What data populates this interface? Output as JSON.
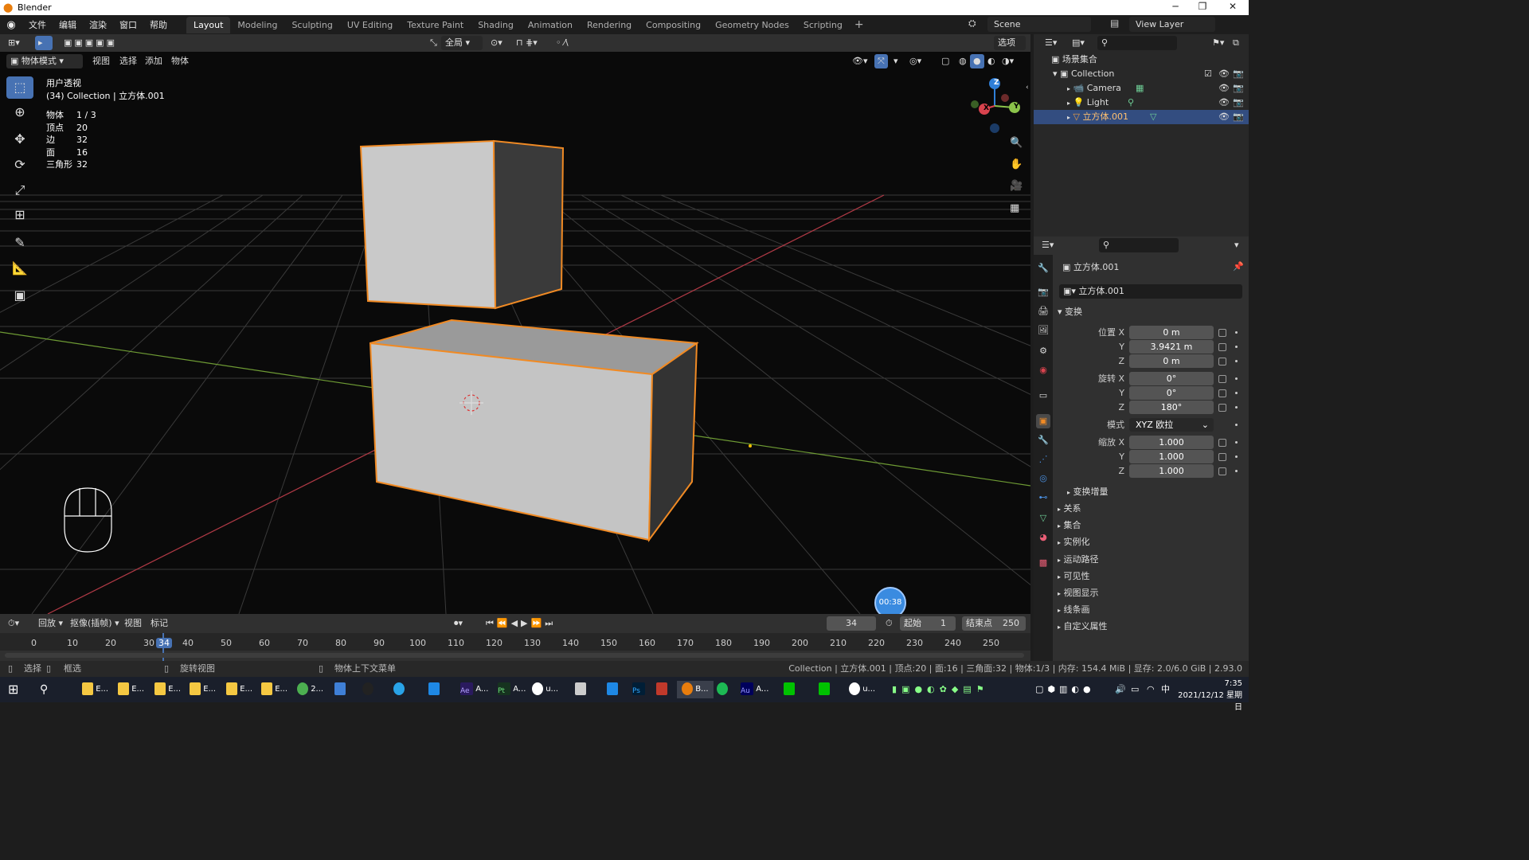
{
  "titlebar": {
    "title": "Blender"
  },
  "menu": {
    "file": "文件",
    "edit": "编辑",
    "render": "渲染",
    "window": "窗口",
    "help": "帮助"
  },
  "workspaces": [
    "Layout",
    "Modeling",
    "Sculpting",
    "UV Editing",
    "Texture Paint",
    "Shading",
    "Animation",
    "Rendering",
    "Compositing",
    "Geometry Nodes",
    "Scripting"
  ],
  "scene": {
    "name": "Scene",
    "view_layer": "View Layer"
  },
  "toolbar": {
    "transform_orientation": "全局",
    "options": "选项"
  },
  "viewport": {
    "mode": "物体模式",
    "menu_view": "视图",
    "menu_select": "选择",
    "menu_add": "添加",
    "menu_object": "物体",
    "view_name": "用户透视",
    "collection_line": "(34) Collection | 立方体.001",
    "stats": [
      {
        "k": "物体",
        "v": "1 / 3"
      },
      {
        "k": "顶点",
        "v": "20"
      },
      {
        "k": "边",
        "v": "32"
      },
      {
        "k": "面",
        "v": "16"
      },
      {
        "k": "三角形",
        "v": "32"
      }
    ],
    "gizmo": {
      "x": "X",
      "y": "Y",
      "z": "Z"
    },
    "timer": "00:38"
  },
  "outliner": {
    "scene_collection": "场景集合",
    "collection": "Collection",
    "items": [
      "Camera",
      "Light",
      "立方体.001"
    ]
  },
  "properties": {
    "object_name": "立方体.001",
    "data_name": "立方体.001",
    "transform_header": "变换",
    "location": {
      "label": "位置 X",
      "x": "0 m",
      "y": "3.9421 m",
      "z": "0 m"
    },
    "rotation": {
      "label": "旋转 X",
      "x": "0°",
      "y": "0°",
      "z": "180°"
    },
    "mode_label": "模式",
    "mode_value": "XYZ 欧拉",
    "scale": {
      "label": "缩放 X",
      "x": "1.000",
      "y": "1.000",
      "z": "1.000"
    },
    "axis_y": "Y",
    "axis_z": "Z",
    "delta": "变换增量",
    "panels": [
      "关系",
      "集合",
      "实例化",
      "运动路径",
      "可见性",
      "视图显示",
      "线条画",
      "自定义属性"
    ]
  },
  "timeline": {
    "playback": "回放",
    "keying": "抠像(插帧)",
    "view": "视图",
    "marker": "标记",
    "current_frame": "34",
    "start_label": "起始",
    "start": "1",
    "end_label": "结束点",
    "end": "250",
    "ticks": [
      "0",
      "10",
      "20",
      "30",
      "34",
      "40",
      "50",
      "60",
      "70",
      "80",
      "90",
      "100",
      "110",
      "120",
      "130",
      "140",
      "150",
      "160",
      "170",
      "180",
      "190",
      "200",
      "210",
      "220",
      "230",
      "240",
      "250"
    ]
  },
  "status": {
    "select": "选择",
    "box": "框选",
    "rotate": "旋转视图",
    "context": "物体上下文菜单",
    "info": "Collection | 立方体.001 | 顶点:20 | 面:16 | 三角面:32 | 物体:1/3 | 内存: 154.4 MiB | 显存: 2.0/6.0 GiB | 2.93.0"
  },
  "taskbar": {
    "apps": [
      "E...",
      "E...",
      "E...",
      "E...",
      "E...",
      "E...",
      "2...",
      "A...",
      "A...",
      "u...",
      "B...",
      "A...",
      "u..."
    ],
    "ps": "Ps",
    "ime": "中",
    "time": "7:35",
    "date": "2021/12/12 星期日"
  },
  "colors": {
    "accent": "#4772b3",
    "select": "#f08a24",
    "xaxis": "#d9434e",
    "yaxis": "#8bc34a",
    "zaxis": "#2f7fd8"
  }
}
